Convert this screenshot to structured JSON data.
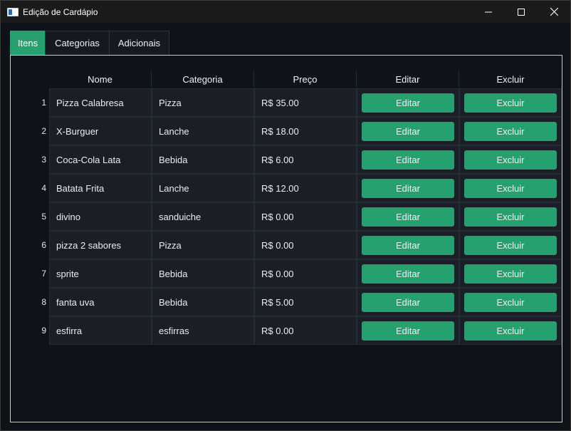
{
  "window": {
    "title": "Edição de Cardápio",
    "controls": {
      "minimize": "minimize-icon",
      "maximize": "maximize-icon",
      "close": "close-icon"
    }
  },
  "tabs": [
    {
      "label": "Itens",
      "active": true
    },
    {
      "label": "Categorias",
      "active": false
    },
    {
      "label": "Adicionais",
      "active": false
    }
  ],
  "table": {
    "headers": [
      "Nome",
      "Categoria",
      "Preço",
      "Editar",
      "Excluir"
    ],
    "rows": [
      {
        "num": "1",
        "nome": "Pizza Calabresa",
        "categoria": "Pizza",
        "preco": "R$ 35.00",
        "editar": "Editar",
        "excluir": "Excluir"
      },
      {
        "num": "2",
        "nome": "X-Burguer",
        "categoria": "Lanche",
        "preco": "R$ 18.00",
        "editar": "Editar",
        "excluir": "Excluir"
      },
      {
        "num": "3",
        "nome": "Coca-Cola Lata",
        "categoria": "Bebida",
        "preco": "R$ 6.00",
        "editar": "Editar",
        "excluir": "Excluir"
      },
      {
        "num": "4",
        "nome": "Batata Frita",
        "categoria": "Lanche",
        "preco": "R$ 12.00",
        "editar": "Editar",
        "excluir": "Excluir"
      },
      {
        "num": "5",
        "nome": "divino",
        "categoria": "sanduiche",
        "preco": "R$ 0.00",
        "editar": "Editar",
        "excluir": "Excluir"
      },
      {
        "num": "6",
        "nome": "pizza 2 sabores",
        "categoria": "Pizza",
        "preco": "R$ 0.00",
        "editar": "Editar",
        "excluir": "Excluir"
      },
      {
        "num": "7",
        "nome": "sprite",
        "categoria": "Bebida",
        "preco": "R$ 0.00",
        "editar": "Editar",
        "excluir": "Excluir"
      },
      {
        "num": "8",
        "nome": "fanta uva",
        "categoria": "Bebida",
        "preco": "R$ 5.00",
        "editar": "Editar",
        "excluir": "Excluir"
      },
      {
        "num": "9",
        "nome": "esfirra",
        "categoria": "esfirras",
        "preco": "R$ 0.00",
        "editar": "Editar",
        "excluir": "Excluir"
      }
    ]
  },
  "colors": {
    "accent": "#26a06e",
    "background": "#0e1219",
    "cell": "#1a1f27"
  }
}
